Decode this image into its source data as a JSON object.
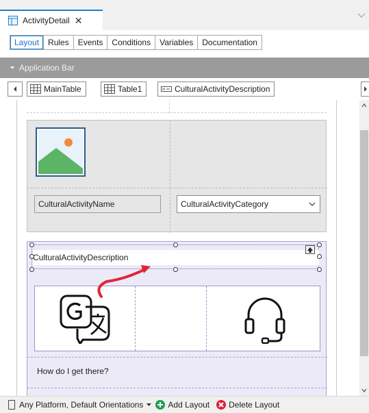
{
  "document_tab": {
    "title": "ActivityDetail",
    "close_glyph": "✕"
  },
  "subtabs": [
    {
      "label": "Layout",
      "active": true
    },
    {
      "label": "Rules"
    },
    {
      "label": "Events"
    },
    {
      "label": "Conditions"
    },
    {
      "label": "Variables"
    },
    {
      "label": "Documentation"
    }
  ],
  "app_bar": {
    "label": "Application Bar"
  },
  "path": {
    "main_table": "MainTable",
    "table1": "Table1",
    "selected_control": "CulturalActivityDescription"
  },
  "canvas": {
    "name_field": "CulturalActivityName",
    "category_field": "CulturalActivityCategory",
    "description_field": "CulturalActivityDescription",
    "how_label": "How do I get there?"
  },
  "bottom_bar": {
    "platform": "Any Platform, Default Orientations",
    "add_layout": "Add Layout",
    "delete_layout": "Delete Layout"
  },
  "colors": {
    "accent": "#1a7fd4",
    "selection_bg": "#edeaf7",
    "arrow_red": "#e0263a",
    "add_green": "#1f9d55",
    "delete_red": "#d9233c"
  },
  "icons": [
    "table-icon",
    "image-placeholder-icon",
    "translate-icon",
    "headset-icon",
    "add-icon",
    "delete-icon"
  ]
}
